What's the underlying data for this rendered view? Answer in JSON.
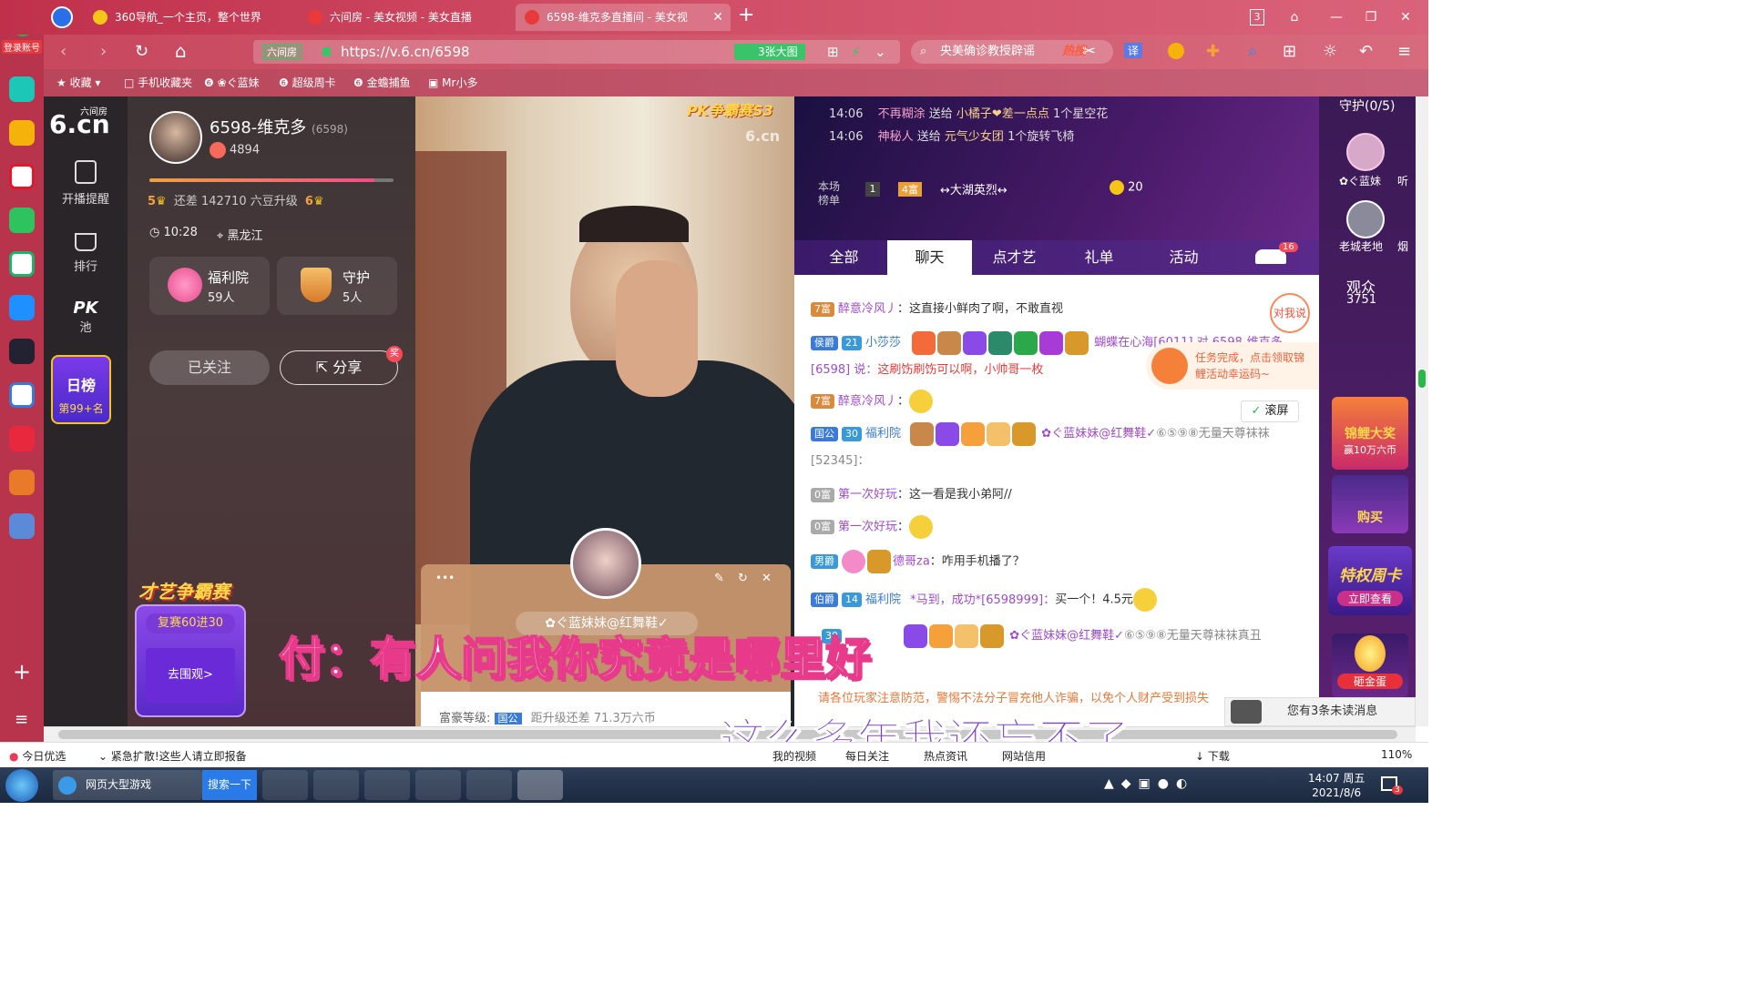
{
  "browser": {
    "tabs": [
      {
        "label": "360导航_一个主页，整个世界",
        "color": "#f5c518"
      },
      {
        "label": "六间房 - 美女视频 - 美女直播",
        "color": "#e83a3a"
      },
      {
        "label": "6598-维克多直播间 - 美女视",
        "color": "#e83a3a"
      }
    ],
    "new_tab": "+",
    "tab_count": "3",
    "url_badge": "六间房",
    "url": "https://v.6.cn/6598",
    "big_image": "3张大图",
    "search_text": "央美确诊教授辟谣",
    "search_hot": "热搜",
    "translate": "译",
    "login": "登录账号",
    "bookmarks": [
      "收藏",
      "手机收藏夹",
      "❀ぐ蓝妹",
      "超级周卡",
      "金蟾捕鱼",
      "Mr小多"
    ]
  },
  "site": {
    "logo_sub": "六间房",
    "logo_main": "6.cn",
    "nav": [
      "开播提醒",
      "排行",
      "PK",
      "池"
    ],
    "daily_rank": "日榜",
    "daily_rank_pos": "第99+名",
    "contest": {
      "title": "才艺争霸赛",
      "round": "复赛60进30",
      "btn": "去围观>"
    }
  },
  "profile": {
    "name": "6598-维克多",
    "id": "(6598)",
    "fans": "4894",
    "upgrade_pre": "5",
    "upgrade_text": "还差 142710 六豆升级",
    "upgrade_post": "6",
    "time": "10:28",
    "location": "黑龙江",
    "welfare": {
      "label": "福利院",
      "count": "59人"
    },
    "guard": {
      "label": "守护",
      "count": "5人"
    },
    "follow": "已关注",
    "share": "分享",
    "reward": "奖"
  },
  "video": {
    "pk_label": "PK争霸赛S3",
    "watermark": "6.cn",
    "popup": {
      "name": "✿ぐ蓝妹妹@红舞鞋✓",
      "rich_label": "富豪等级:",
      "rich_badge": "国公",
      "rich_progress": "距升级还差 71.3万六币",
      "menu": "•••"
    }
  },
  "subtitles": {
    "line1": "付：有人问我你究竟是哪里好",
    "line2": "这么多年我还忘不了"
  },
  "chat": {
    "top_msgs": [
      {
        "time": "14:06",
        "from": "不再糊涂",
        "verb": "送给",
        "to": "小橘子❤差一点点",
        "gift": "1个星空花"
      },
      {
        "time": "14:06",
        "from": "神秘人",
        "verb": "送给",
        "to": "元气少女团",
        "gift": "1个旋转飞椅"
      }
    ],
    "rank_label": "本场榜单",
    "rank_pos": "1",
    "rank_badge": "4富",
    "rank_name": "↔大湖英烈↔",
    "rank_coins": "20",
    "tabs": [
      "全部",
      "聊天",
      "点才艺",
      "礼单",
      "活动"
    ],
    "car_count": "16",
    "messages": [
      {
        "badge": "7富",
        "badge_color": "#d98a3a",
        "nick": "醉意冷风丿",
        "text": "：这直接小鲜肉了啊，不敢直视"
      },
      {
        "badge": "侯爵",
        "badge_color": "#3a7ad9",
        "nick": "小莎莎",
        "level": "21",
        "extra": "蝴蝶在心海[6011] 对 6598-维克多[6598] 说：",
        "text": "这刷饬刷饬可以啊，小帅哥一枚"
      },
      {
        "badge": "7富",
        "badge_color": "#d98a3a",
        "nick": "醉意冷风丿",
        "text": "："
      },
      {
        "badge": "国公",
        "badge_color": "#3a7ad9",
        "nick": "福利院",
        "level": "30",
        "extra": "✿ぐ蓝妹妹@红舞鞋✓",
        "text": "⑥⑤⑨⑧无量天尊袜袜[52345]："
      },
      {
        "badge": "0富",
        "badge_color": "#aaa",
        "nick": "第一次好玩",
        "text": "：这一看是我小弟阿//"
      },
      {
        "badge": "0富",
        "badge_color": "#aaa",
        "nick": "第一次好玩",
        "text": "："
      },
      {
        "badge": "男爵",
        "badge_color": "#3a9ad9",
        "nick": "德哥za",
        "text": "：咋用手机播了？"
      },
      {
        "badge": "伯爵",
        "badge_color": "#3a7ad9",
        "nick": "福利院",
        "level": "14",
        "extra": "*马到，成功*[6598999]：",
        "text": "买一个！4.5元"
      },
      {
        "badge": "",
        "badge_color": "#3a7ad9",
        "nick": "",
        "level": "30",
        "extra": "✿ぐ蓝妹妹@红舞鞋✓",
        "text": "⑥⑤⑨⑧无量天尊袜袜真丑"
      }
    ],
    "to_me": "对我说",
    "task_notice": "任务完成，点击领取锦鲤活动幸运码~",
    "scroll_lock": "滚屏",
    "warning": "请各位玩家注意防范，警惕不法分子冒充他人诈骗，以免个人财产受到损失",
    "unread": "您有3条未读消息"
  },
  "right": {
    "guard_label": "守护(0/5)",
    "guard1": "✿ぐ蓝妹",
    "guard1b": "听",
    "guard2": "老城老地",
    "guard2b": "烟",
    "audience_label": "观众",
    "audience_count": "3751",
    "promo1": "锦鲤大奖",
    "promo1_sub": "赢10万六币",
    "promo_buy": "购买",
    "promo2": "特权周卡",
    "promo2_btn": "立即查看",
    "promo3": "砸金蛋",
    "promo3_btn": "砸金蛋"
  },
  "statusbar": {
    "left1": "今日优选",
    "left2": "紧急扩散!这些人请立即报备",
    "items": [
      "我的视频",
      "每日关注",
      "热点资讯",
      "网站信用"
    ],
    "download": "下载",
    "zoom": "110%"
  },
  "taskbar": {
    "app1": "网页大型游戏",
    "search": "搜索一下",
    "time": "14:07 周五",
    "date": "2021/8/6",
    "notif": "3"
  }
}
